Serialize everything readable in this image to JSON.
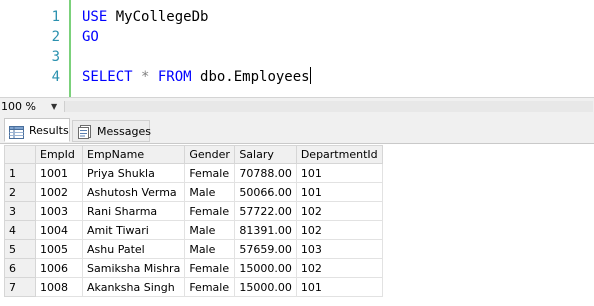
{
  "editor": {
    "lines": [
      {
        "number": "1",
        "keyword": "USE",
        "text": " MyCollegeDb"
      },
      {
        "number": "2",
        "keyword": "GO",
        "text": ""
      },
      {
        "number": "3",
        "keyword": "",
        "text": ""
      },
      {
        "number": "4",
        "keyword": "SELECT",
        "star": " * ",
        "keyword2": "FROM",
        "text": " dbo.Employees"
      }
    ]
  },
  "zoom": {
    "value": "100 %"
  },
  "tabs": {
    "results": "Results",
    "messages": "Messages"
  },
  "grid": {
    "columns": [
      "EmpId",
      "EmpName",
      "Gender",
      "Salary",
      "DepartmentId"
    ],
    "rows": [
      {
        "n": "1",
        "EmpId": "1001",
        "EmpName": "Priya Shukla",
        "Gender": "Female",
        "Salary": "70788.00",
        "DepartmentId": "101"
      },
      {
        "n": "2",
        "EmpId": "1002",
        "EmpName": "Ashutosh Verma",
        "Gender": "Male",
        "Salary": "50066.00",
        "DepartmentId": "101"
      },
      {
        "n": "3",
        "EmpId": "1003",
        "EmpName": "Rani Sharma",
        "Gender": "Female",
        "Salary": "57722.00",
        "DepartmentId": "102"
      },
      {
        "n": "4",
        "EmpId": "1004",
        "EmpName": "Amit Tiwari",
        "Gender": "Male",
        "Salary": "81391.00",
        "DepartmentId": "102"
      },
      {
        "n": "5",
        "EmpId": "1005",
        "EmpName": "Ashu Patel",
        "Gender": "Male",
        "Salary": "57659.00",
        "DepartmentId": "103"
      },
      {
        "n": "6",
        "EmpId": "1006",
        "EmpName": "Samiksha Mishra",
        "Gender": "Female",
        "Salary": "15000.00",
        "DepartmentId": "102"
      },
      {
        "n": "7",
        "EmpId": "1008",
        "EmpName": "Akanksha Singh",
        "Gender": "Female",
        "Salary": "15000.00",
        "DepartmentId": "101"
      }
    ]
  },
  "colors": {
    "keyword": "#0000ff",
    "line_number": "#2b91af",
    "change_margin": "#7bd17b"
  },
  "icons": {
    "results_tab": "grid-icon",
    "messages_tab": "messages-icon",
    "zoom_dropdown": "dropdown-arrow-icon"
  }
}
